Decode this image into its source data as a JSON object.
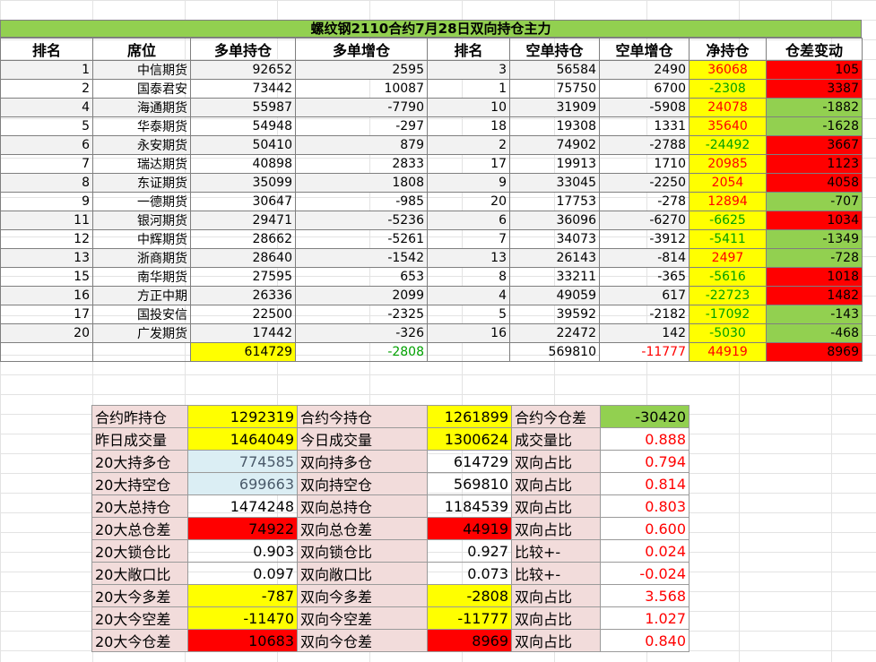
{
  "title": "螺纹钢2110合约7月28日双向持仓主力",
  "headers": [
    "排名",
    "席位",
    "多单持仓",
    "多单增仓",
    "排名",
    "空单持仓",
    "空单增仓",
    "净持仓",
    "仓差变动"
  ],
  "rows": [
    {
      "rank": "1",
      "firm": "中信期货",
      "long": "92652",
      "long_chg": "2595",
      "srank": "3",
      "short": "56584",
      "short_chg": "2490",
      "net": "36068",
      "diff": "105",
      "net_sign": "pos",
      "diff_color": "red"
    },
    {
      "rank": "2",
      "firm": "国泰君安",
      "long": "73442",
      "long_chg": "10087",
      "srank": "1",
      "short": "75750",
      "short_chg": "6700",
      "net": "-2308",
      "diff": "3387",
      "net_sign": "neg",
      "diff_color": "red"
    },
    {
      "rank": "4",
      "firm": "海通期货",
      "long": "55987",
      "long_chg": "-7790",
      "srank": "10",
      "short": "31909",
      "short_chg": "-5908",
      "net": "24078",
      "diff": "-1882",
      "net_sign": "pos",
      "diff_color": "green"
    },
    {
      "rank": "5",
      "firm": "华泰期货",
      "long": "54948",
      "long_chg": "-297",
      "srank": "18",
      "short": "19308",
      "short_chg": "1331",
      "net": "35640",
      "diff": "-1628",
      "net_sign": "pos",
      "diff_color": "green"
    },
    {
      "rank": "6",
      "firm": "永安期货",
      "long": "50410",
      "long_chg": "879",
      "srank": "2",
      "short": "74902",
      "short_chg": "-2788",
      "net": "-24492",
      "diff": "3667",
      "net_sign": "neg",
      "diff_color": "red"
    },
    {
      "rank": "7",
      "firm": "瑞达期货",
      "long": "40898",
      "long_chg": "2833",
      "srank": "17",
      "short": "19913",
      "short_chg": "1710",
      "net": "20985",
      "diff": "1123",
      "net_sign": "pos",
      "diff_color": "red"
    },
    {
      "rank": "8",
      "firm": "东证期货",
      "long": "35099",
      "long_chg": "1808",
      "srank": "9",
      "short": "33045",
      "short_chg": "-2250",
      "net": "2054",
      "diff": "4058",
      "net_sign": "pos",
      "diff_color": "red"
    },
    {
      "rank": "9",
      "firm": "一德期货",
      "long": "30647",
      "long_chg": "-985",
      "srank": "20",
      "short": "17753",
      "short_chg": "-278",
      "net": "12894",
      "diff": "-707",
      "net_sign": "pos",
      "diff_color": "green"
    },
    {
      "rank": "11",
      "firm": "银河期货",
      "long": "29471",
      "long_chg": "-5236",
      "srank": "6",
      "short": "36096",
      "short_chg": "-6270",
      "net": "-6625",
      "diff": "1034",
      "net_sign": "neg",
      "diff_color": "red"
    },
    {
      "rank": "12",
      "firm": "中辉期货",
      "long": "28662",
      "long_chg": "-5261",
      "srank": "7",
      "short": "34073",
      "short_chg": "-3912",
      "net": "-5411",
      "diff": "-1349",
      "net_sign": "neg",
      "diff_color": "green"
    },
    {
      "rank": "13",
      "firm": "浙商期货",
      "long": "28640",
      "long_chg": "-1542",
      "srank": "13",
      "short": "26143",
      "short_chg": "-814",
      "net": "2497",
      "diff": "-728",
      "net_sign": "pos",
      "diff_color": "green"
    },
    {
      "rank": "15",
      "firm": "南华期货",
      "long": "27595",
      "long_chg": "653",
      "srank": "8",
      "short": "33211",
      "short_chg": "-365",
      "net": "-5616",
      "diff": "1018",
      "net_sign": "neg",
      "diff_color": "red"
    },
    {
      "rank": "16",
      "firm": "方正中期",
      "long": "26336",
      "long_chg": "2099",
      "srank": "4",
      "short": "49059",
      "short_chg": "617",
      "net": "-22723",
      "diff": "1482",
      "net_sign": "neg",
      "diff_color": "red"
    },
    {
      "rank": "17",
      "firm": "国投安信",
      "long": "22500",
      "long_chg": "-2325",
      "srank": "5",
      "short": "39592",
      "short_chg": "-2182",
      "net": "-17092",
      "diff": "-143",
      "net_sign": "neg",
      "diff_color": "green"
    },
    {
      "rank": "20",
      "firm": "广发期货",
      "long": "17442",
      "long_chg": "-326",
      "srank": "16",
      "short": "22472",
      "short_chg": "142",
      "net": "-5030",
      "diff": "-468",
      "net_sign": "neg",
      "diff_color": "green"
    }
  ],
  "totals": {
    "long": "614729",
    "long_chg": "-2808",
    "short": "569810",
    "short_chg": "-11777",
    "net": "44919",
    "diff": "8969"
  },
  "stats": [
    {
      "l1": "合约昨持仓",
      "v1": "1292319",
      "l2": "合约今持仓",
      "v2": "1261899",
      "l3": "合约今仓差",
      "v3": "-30420",
      "c1": "yel",
      "c2": "yel",
      "c3": "grn"
    },
    {
      "l1": "昨日成交量",
      "v1": "1464049",
      "l2": "今日成交量",
      "v2": "1300624",
      "l3": "成交量比",
      "v3": "0.888",
      "c1": "yel",
      "c2": "yel",
      "c3": "pct"
    },
    {
      "l1": "20大持多仓",
      "v1": "774585",
      "l2": "双向持多仓",
      "v2": "614729",
      "l3": "双向占比",
      "v3": "0.794",
      "c1": "blue",
      "c2": "",
      "c3": "pct"
    },
    {
      "l1": "20大持空仓",
      "v1": "699663",
      "l2": "双向持空仓",
      "v2": "569810",
      "l3": "双向占比",
      "v3": "0.814",
      "c1": "blue",
      "c2": "",
      "c3": "pct"
    },
    {
      "l1": "20大总持仓",
      "v1": "1474248",
      "l2": "双向总持仓",
      "v2": "1184539",
      "l3": "双向占比",
      "v3": "0.803",
      "c1": "",
      "c2": "",
      "c3": "pct"
    },
    {
      "l1": "20大总仓差",
      "v1": "74922",
      "l2": "双向总仓差",
      "v2": "44919",
      "l3": "双向占比",
      "v3": "0.600",
      "c1": "red",
      "c2": "red",
      "c3": "pct"
    },
    {
      "l1": "20大锁仓比",
      "v1": "0.903",
      "l2": "双向锁仓比",
      "v2": "0.927",
      "l3": "比较+-",
      "v3": "0.024",
      "c1": "",
      "c2": "",
      "c3": "pct"
    },
    {
      "l1": "20大敞口比",
      "v1": "0.097",
      "l2": "双向敞口比",
      "v2": "0.073",
      "l3": "比较+-",
      "v3": "-0.024",
      "c1": "",
      "c2": "",
      "c3": "pct"
    },
    {
      "l1": "20大今多差",
      "v1": "-787",
      "l2": "双向今多差",
      "v2": "-2808",
      "l3": "双向占比",
      "v3": "3.568",
      "c1": "yel",
      "c2": "yel",
      "c3": "pct"
    },
    {
      "l1": "20大今空差",
      "v1": "-11470",
      "l2": "双向今空差",
      "v2": "-11777",
      "l3": "双向占比",
      "v3": "1.027",
      "c1": "yel",
      "c2": "yel",
      "c3": "pct"
    },
    {
      "l1": "20大今仓差",
      "v1": "10683",
      "l2": "双向今仓差",
      "v2": "8969",
      "l3": "双向占比",
      "v3": "0.840",
      "c1": "red",
      "c2": "red",
      "c3": "pct"
    }
  ]
}
